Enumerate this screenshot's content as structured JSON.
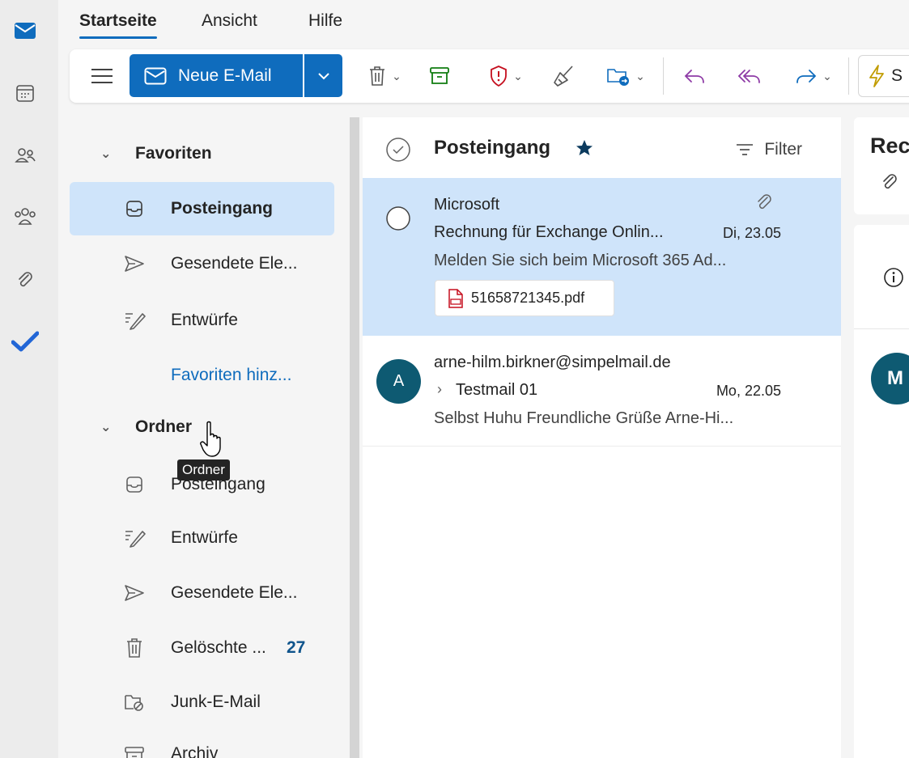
{
  "tabs": [
    {
      "label": "Startseite",
      "active": true
    },
    {
      "label": "Ansicht",
      "active": false
    },
    {
      "label": "Hilfe",
      "active": false
    }
  ],
  "ribbon": {
    "new_mail_label": "Neue E-Mail",
    "truncated_label": "S"
  },
  "folders": {
    "favorites_header": "Favoriten",
    "favorites": [
      {
        "label": "Posteingang",
        "icon": "inbox-icon",
        "selected": true
      },
      {
        "label": "Gesendete Ele...",
        "icon": "send-icon"
      },
      {
        "label": "Entwürfe",
        "icon": "drafts-icon"
      }
    ],
    "add_favorite_label": "Favoriten hinz...",
    "folders_header": "Ordner",
    "folders": [
      {
        "label": "Posteingang",
        "icon": "inbox-icon"
      },
      {
        "label": "Entwürfe",
        "icon": "drafts-icon"
      },
      {
        "label": "Gesendete Ele...",
        "icon": "send-icon"
      },
      {
        "label": "Gelöschte ...",
        "icon": "trash-icon",
        "count": "27"
      },
      {
        "label": "Junk-E-Mail",
        "icon": "junk-icon"
      },
      {
        "label": "Archiv",
        "icon": "archive-icon"
      }
    ],
    "tooltip": "Ordner"
  },
  "message_list": {
    "title": "Posteingang",
    "filter_label": "Filter",
    "messages": [
      {
        "sender": "Microsoft",
        "subject": "Rechnung für Exchange Onlin...",
        "date": "Di, 23.05",
        "preview": "Melden Sie sich beim Microsoft 365 Ad...",
        "attachment": "51658721345.pdf",
        "selected": true
      },
      {
        "sender": "arne-hilm.birkner@simpelmail.de",
        "subject": "Testmail 01",
        "date": "Mo, 22.05",
        "preview": "Selbst Huhu Freundliche Grüße Arne-Hi...",
        "avatar_initial": "A"
      }
    ]
  },
  "reading_pane": {
    "title_partial": "Rec",
    "avatar_initial": "M"
  },
  "colors": {
    "accent": "#0f6cbd",
    "selection": "#cfe4fa",
    "avatar": "#0e5a72"
  }
}
